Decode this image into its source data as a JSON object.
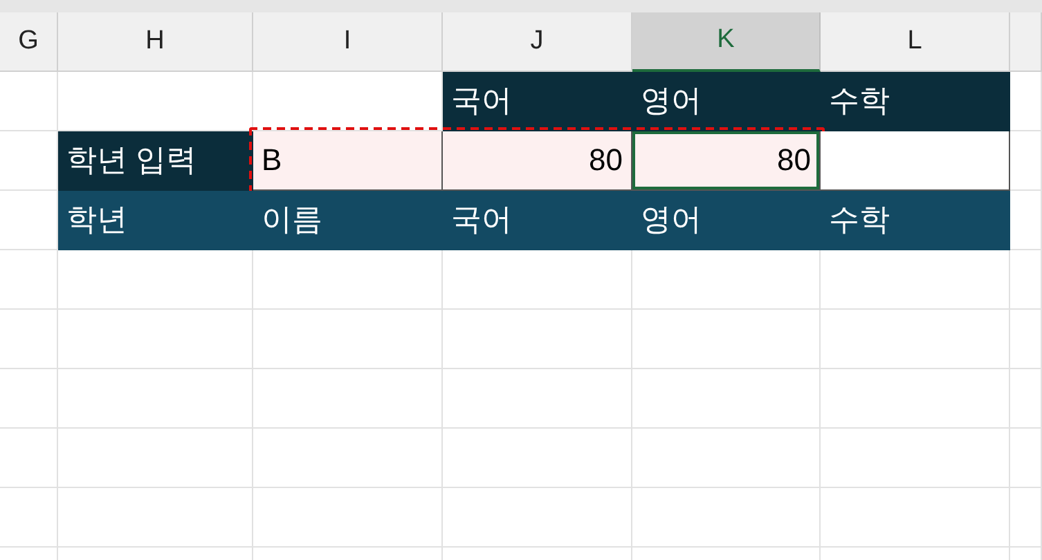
{
  "columns": [
    {
      "label": "G",
      "selected": false
    },
    {
      "label": "H",
      "selected": false
    },
    {
      "label": "I",
      "selected": false
    },
    {
      "label": "J",
      "selected": false
    },
    {
      "label": "K",
      "selected": true
    },
    {
      "label": "L",
      "selected": false
    },
    {
      "selected": false
    }
  ],
  "rows": [
    {
      "cells": [
        {
          "kind": "blank",
          "selected": false,
          "copied": false
        },
        {
          "kind": "blank",
          "selected": false,
          "copied": false
        },
        {
          "kind": "blank",
          "selected": false,
          "copied": false
        },
        {
          "kind": "dark",
          "text": "국어",
          "selected": false,
          "copied": false
        },
        {
          "kind": "dark",
          "text": "영어",
          "selected": false,
          "copied": false
        },
        {
          "kind": "dark",
          "text": "수학",
          "selected": false,
          "copied": false
        },
        {
          "kind": "blank",
          "selected": false,
          "copied": false
        }
      ]
    },
    {
      "cells": [
        {
          "kind": "blank",
          "selected": false,
          "copied": false
        },
        {
          "kind": "dark",
          "text": "학년 입력",
          "selected": false,
          "copied": false
        },
        {
          "kind": "input_text",
          "text": "B",
          "selected": false,
          "copied": true
        },
        {
          "kind": "input_number",
          "text": "80",
          "selected": false,
          "copied": true
        },
        {
          "kind": "input_number",
          "text": "80",
          "selected": true,
          "copied": true
        },
        {
          "kind": "boxed",
          "selected": false,
          "copied": false
        },
        {
          "kind": "blank",
          "selected": false,
          "copied": false
        }
      ]
    },
    {
      "cells": [
        {
          "kind": "blank",
          "selected": false,
          "copied": false
        },
        {
          "kind": "band",
          "text": "학년",
          "selected": false,
          "copied": false
        },
        {
          "kind": "band",
          "text": "이름",
          "selected": false,
          "copied": false
        },
        {
          "kind": "band",
          "text": "국어",
          "selected": false,
          "copied": false
        },
        {
          "kind": "band",
          "text": "영어",
          "selected": false,
          "copied": false
        },
        {
          "kind": "band",
          "text": "수학",
          "selected": false,
          "copied": false
        },
        {
          "kind": "blank",
          "selected": false,
          "copied": false
        }
      ]
    }
  ]
}
